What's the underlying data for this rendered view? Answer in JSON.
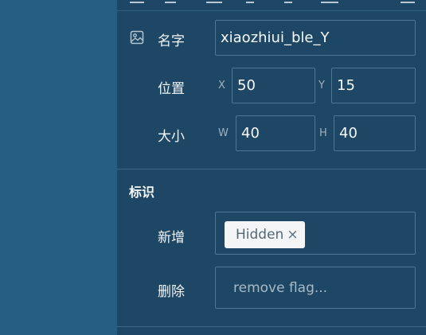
{
  "name_row": {
    "label": "名字",
    "value": "xiaozhiui_ble_Y",
    "icon": "image-icon"
  },
  "position_row": {
    "label": "位置",
    "x_axis": "X",
    "x_value": "50",
    "y_axis": "Y",
    "y_value": "15"
  },
  "size_row": {
    "label": "大小",
    "w_axis": "W",
    "w_value": "40",
    "h_axis": "H",
    "h_value": "40"
  },
  "flags_section": {
    "title": "标识",
    "add_label": "新增",
    "add_tags": [
      {
        "label": "Hidden",
        "remove_glyph": "×"
      }
    ],
    "remove_label": "删除",
    "remove_placeholder": "remove flag..."
  },
  "colors": {
    "panel_bg": "#1d4765",
    "side_bg": "#255e80",
    "field_border": "#4d7894"
  }
}
